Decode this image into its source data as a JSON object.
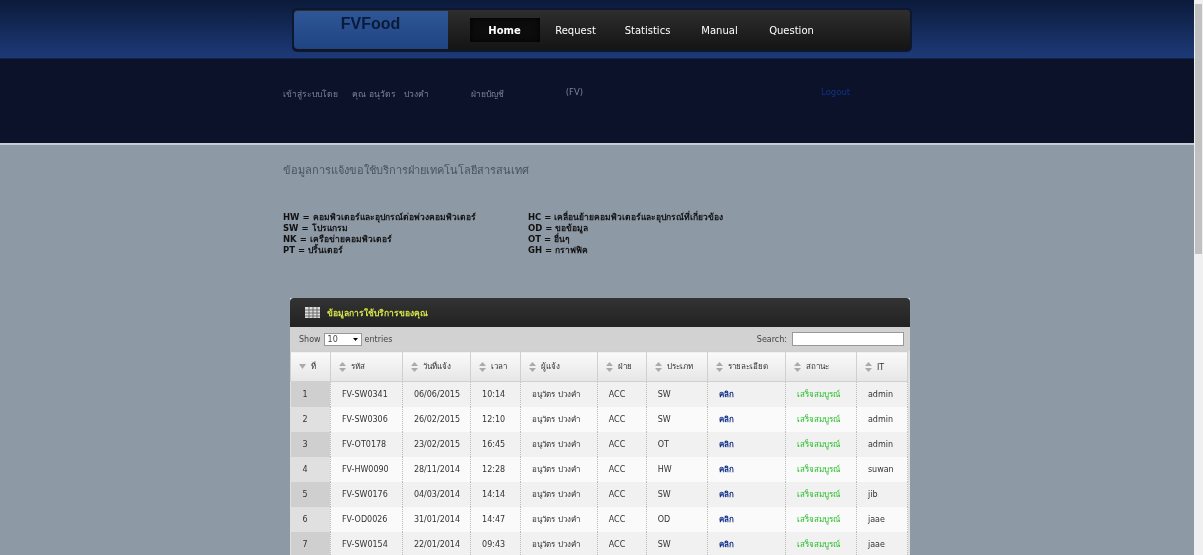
{
  "brand": "FVFood",
  "nav": [
    {
      "label": "Home",
      "selected": true
    },
    {
      "label": "Request",
      "selected": false
    },
    {
      "label": "Statistics",
      "selected": false
    },
    {
      "label": "Manual",
      "selected": false
    },
    {
      "label": "Question",
      "selected": false
    }
  ],
  "user_bar": {
    "login_label": "เข้าสู่ระบบโดย",
    "user_name": "คุณ อนุวัตร",
    "user_surname": "ปวงคำ",
    "department": "ฝ่ายบัญชี",
    "company": "(FV)",
    "logout": "Logout"
  },
  "page_title": "ข้อมูลการแจ้งขอใช้บริการฝ่ายเทคโนโลยีสารสนเทศ",
  "legend": [
    [
      "HW = คอมพิวเตอร์และอุปกรณ์ต่อพ่วงคอมพิวเตอร์",
      "SW = โปรแกรม",
      "NK = เครือข่ายคอมพิวเตอร์",
      "PT  = ปริ้นเตอร์"
    ],
    [
      "HC = เคลื่อนย้ายคอมพิวเตอร์และอุปกรณ์ที่เกี่ยวข้อง",
      "OD = ขอข้อมูล",
      "OT = อื่นๆ",
      "GH = กราฟฟิค"
    ]
  ],
  "panel_title": "ข้อมูลการใช้บริการของคุณ",
  "controls": {
    "show_label": "Show",
    "page_size": "10",
    "entries_label": "entries",
    "search_label": "Search:"
  },
  "table": {
    "columns": [
      {
        "label": "ที่",
        "sorted": true
      },
      {
        "label": "รหัส",
        "sorted": false
      },
      {
        "label": "วันที่แจ้ง",
        "sorted": false
      },
      {
        "label": "เวลา",
        "sorted": false
      },
      {
        "label": "ผู้แจ้ง",
        "sorted": false
      },
      {
        "label": "ฝ่าย",
        "sorted": false
      },
      {
        "label": "ประเภท",
        "sorted": false
      },
      {
        "label": "รายละเอียด",
        "sorted": false
      },
      {
        "label": "สถานะ",
        "sorted": false
      },
      {
        "label": "IT",
        "sorted": false
      }
    ],
    "rows": [
      [
        "1",
        "FV-SW0341",
        "06/06/2015",
        "10:14",
        "อนุวัตร ปวงคำ",
        "ACC",
        "SW",
        "คลิก",
        "เสร็จสมบูรณ์",
        "admin"
      ],
      [
        "2",
        "FV-SW0306",
        "26/02/2015",
        "12:10",
        "อนุวัตร ปวงคำ",
        "ACC",
        "SW",
        "คลิก",
        "เสร็จสมบูรณ์",
        "admin"
      ],
      [
        "3",
        "FV-OT0178",
        "23/02/2015",
        "16:45",
        "อนุวัตร ปวงคำ",
        "ACC",
        "OT",
        "คลิก",
        "เสร็จสมบูรณ์",
        "admin"
      ],
      [
        "4",
        "FV-HW0090",
        "28/11/2014",
        "12:28",
        "อนุวัตร ปวงคำ",
        "ACC",
        "HW",
        "คลิก",
        "เสร็จสมบูรณ์",
        "suwan"
      ],
      [
        "5",
        "FV-SW0176",
        "04/03/2014",
        "14:14",
        "อนุวัตร ปวงคำ",
        "ACC",
        "SW",
        "คลิก",
        "เสร็จสมบูรณ์",
        "jib"
      ],
      [
        "6",
        "FV-OD0026",
        "31/01/2014",
        "14:47",
        "อนุวัตร ปวงคำ",
        "ACC",
        "OD",
        "คลิก",
        "เสร็จสมบูรณ์",
        "jaae"
      ],
      [
        "7",
        "FV-SW0154",
        "22/01/2014",
        "09:43",
        "อนุวัตร ปวงคำ",
        "ACC",
        "SW",
        "คลิก",
        "เสร็จสมบูรณ์",
        "jaae"
      ]
    ]
  }
}
